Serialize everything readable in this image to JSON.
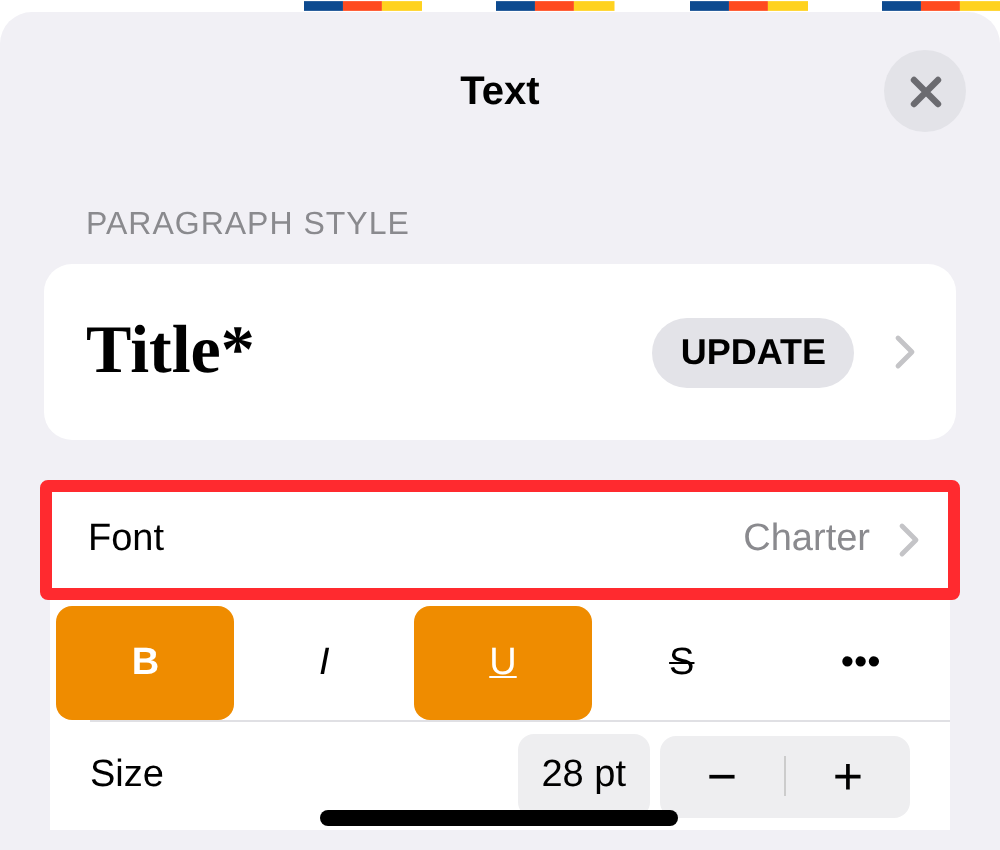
{
  "sheet": {
    "title": "Text"
  },
  "paragraph_style": {
    "heading": "PARAGRAPH STYLE",
    "style_name": "Title*",
    "update_button": "UPDATE"
  },
  "font": {
    "label": "Font",
    "value": "Charter",
    "highlighted": true
  },
  "style_buttons": [
    {
      "kind": "bold",
      "label": "B",
      "selected": true
    },
    {
      "kind": "italic",
      "label": "I",
      "selected": false
    },
    {
      "kind": "underline",
      "label": "U",
      "selected": true
    },
    {
      "kind": "strike",
      "label": "S",
      "selected": false
    },
    {
      "kind": "more",
      "label": "•••",
      "selected": false
    }
  ],
  "size": {
    "label": "Size",
    "value": "28 pt",
    "decrease": "−",
    "increase": "+"
  }
}
